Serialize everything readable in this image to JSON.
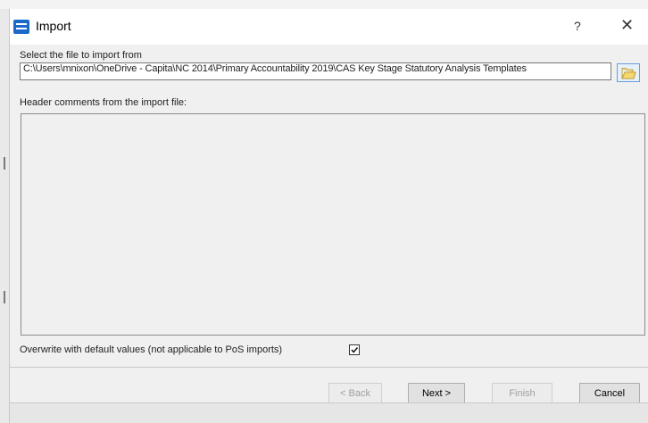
{
  "window": {
    "title": "Import",
    "help_glyph": "?",
    "close_glyph": "✕",
    "app_icon": "app-logo-icon"
  },
  "file_select": {
    "label": "Select the file to import from",
    "path": "C:\\Users\\mnixon\\OneDrive - Capita\\NC 2014\\Primary Accountability 2019\\CAS Key Stage Statutory Analysis Templates",
    "browse_icon": "folder-open-icon"
  },
  "header_comments": {
    "label": "Header comments from the import file:",
    "value": ""
  },
  "options": {
    "overwrite_label": "Overwrite with default values (not applicable to PoS imports)",
    "overwrite_checked": true
  },
  "buttons": {
    "back": "< Back",
    "next": "Next >",
    "finish": "Finish",
    "cancel": "Cancel"
  },
  "colors": {
    "dialog_bg": "#f0f0f0",
    "accent": "#1b6ac9",
    "disabled_text": "#a0a0a0"
  }
}
